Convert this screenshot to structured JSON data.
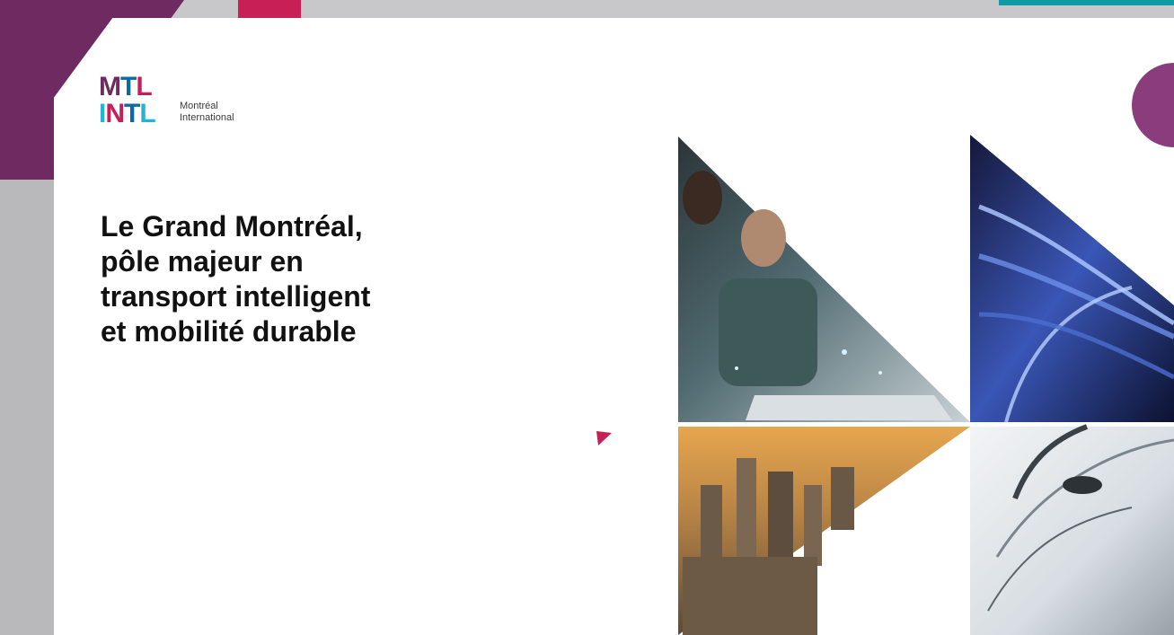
{
  "logo": {
    "top_word": "MTL",
    "bottom_word": "INTL",
    "org_line_1": "Montréal",
    "org_line_2": "International"
  },
  "headline": {
    "lines": [
      "Le Grand Montréal,",
      "pôle majeur en",
      "transport intelligent",
      "et mobilité durable"
    ]
  },
  "mosaic": {
    "tiles": [
      "people-at-laptop-photo",
      "highway-light-trails-photo",
      "city-skyline-sunset-photo",
      "electric-car-charging-photo"
    ]
  },
  "colors": {
    "purple": "#6e2a61",
    "magenta": "#c71f56",
    "blue": "#0a6aa8",
    "cyan": "#22b3d6",
    "teal": "#0f9aa6"
  }
}
